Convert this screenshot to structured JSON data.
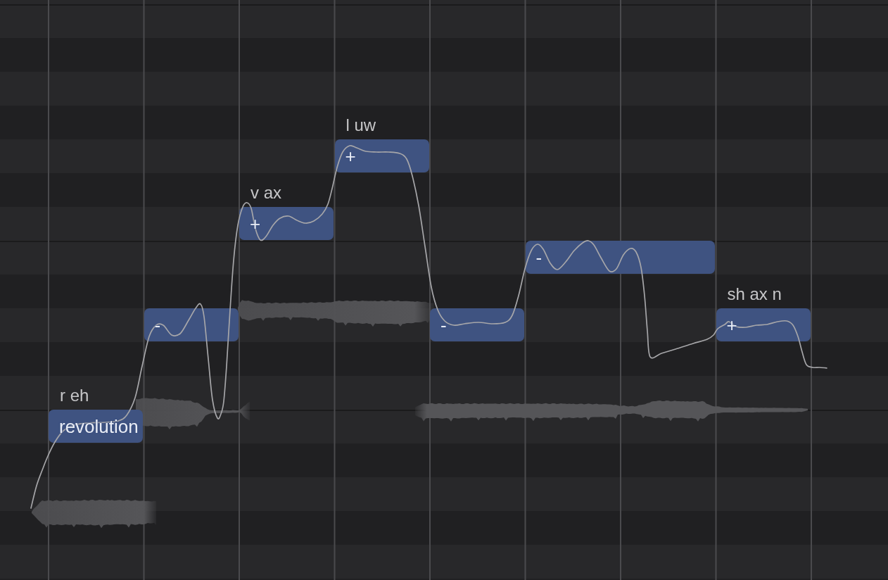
{
  "piano_roll": {
    "notes": [
      {
        "lyric": "revolution",
        "phonemes": "r eh"
      },
      {
        "lyric": "-"
      },
      {
        "lyric": "+",
        "phonemes": "v ax"
      },
      {
        "lyric": "+",
        "phonemes": "l uw"
      },
      {
        "lyric": "-"
      },
      {
        "lyric": "-"
      },
      {
        "lyric": "+",
        "phonemes": "sh ax n"
      }
    ]
  }
}
